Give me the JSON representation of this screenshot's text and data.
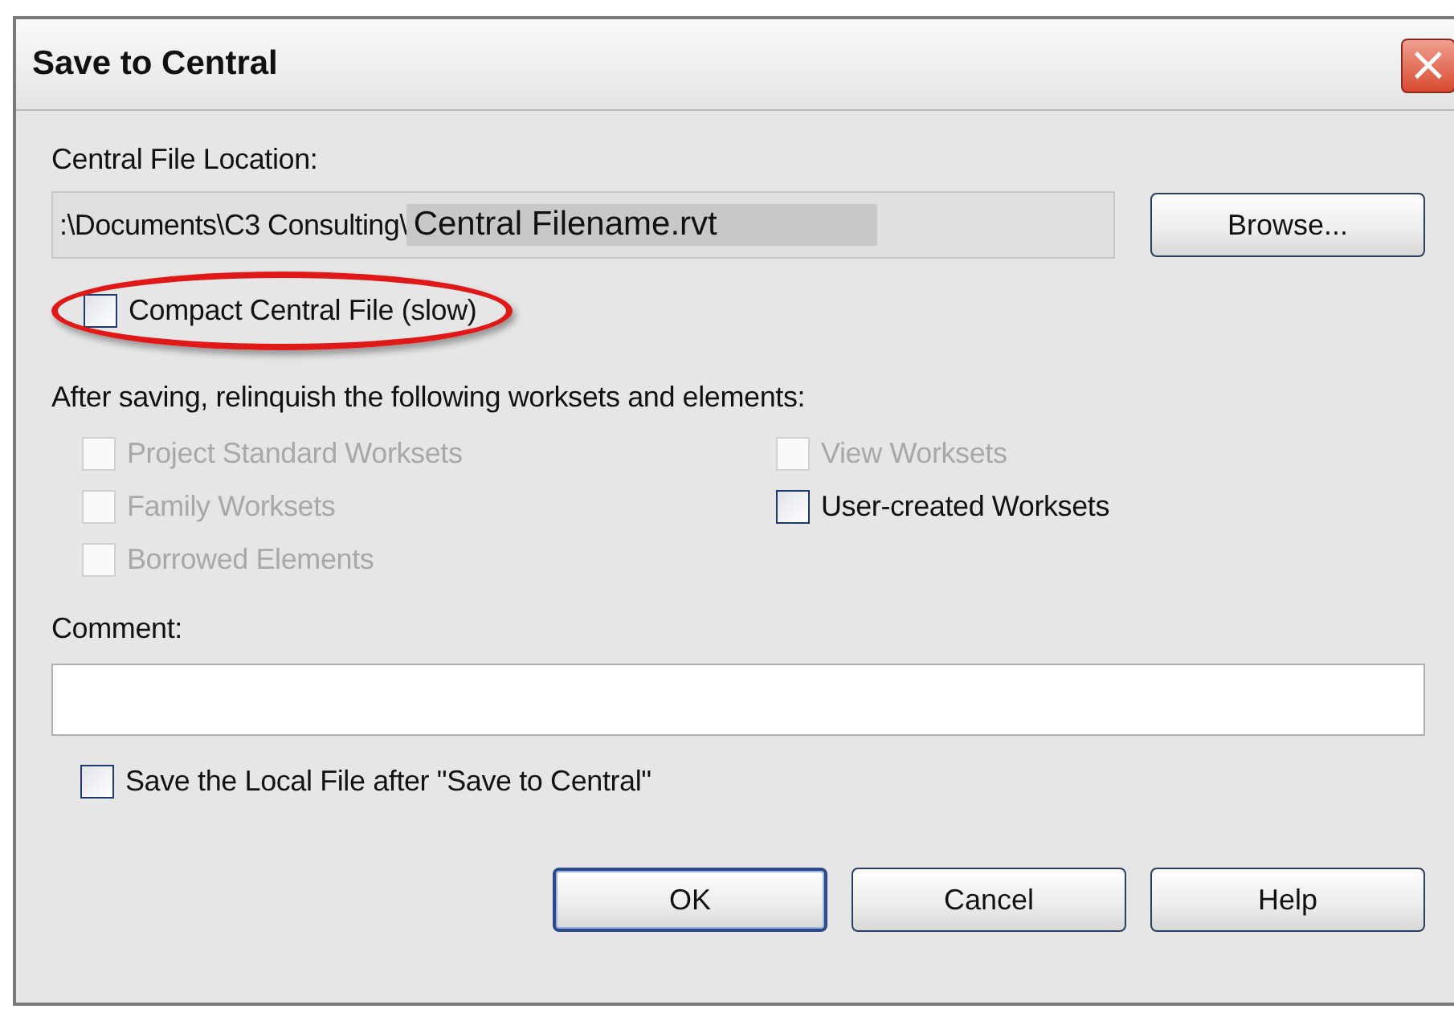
{
  "window": {
    "title": "Save to Central",
    "close": "×"
  },
  "location": {
    "label": "Central File Location:",
    "path_prefix": ":\\Documents\\C3 Consulting\\",
    "file_name": "Central Filename.rvt",
    "browse": "Browse..."
  },
  "compact": {
    "label": "Compact Central File (slow)",
    "checked": false,
    "disabled": false,
    "highlighted": true
  },
  "relinquish": {
    "label": "After saving, relinquish the following worksets and elements:",
    "options": [
      {
        "label": "Project Standard Worksets",
        "checked": false,
        "disabled": true
      },
      {
        "label": "Family Worksets",
        "checked": false,
        "disabled": true
      },
      {
        "label": "Borrowed Elements",
        "checked": false,
        "disabled": true
      },
      {
        "label": "View Worksets",
        "checked": false,
        "disabled": true
      },
      {
        "label": "User-created Worksets",
        "checked": false,
        "disabled": false
      }
    ]
  },
  "comment": {
    "label": "Comment:"
  },
  "save_local": {
    "label": "Save the Local File after \"Save to Central\"",
    "checked": false,
    "disabled": false
  },
  "buttons": [
    {
      "label": "OK",
      "default": true
    },
    {
      "label": "Cancel",
      "default": false
    },
    {
      "label": "Help",
      "default": false
    }
  ]
}
